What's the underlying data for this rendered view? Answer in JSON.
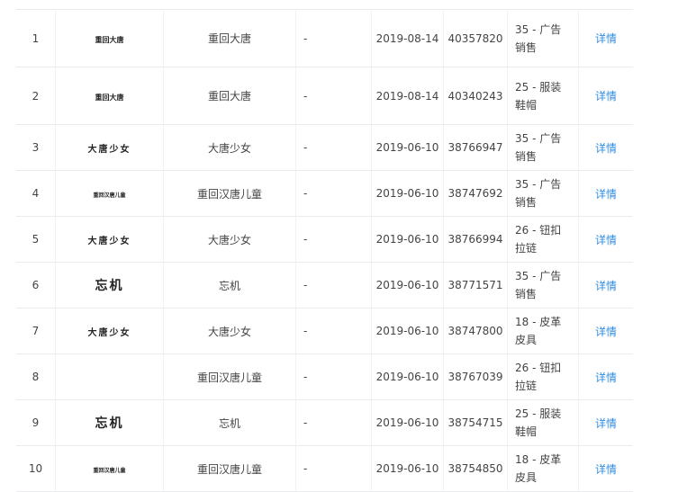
{
  "table": {
    "rows": [
      {
        "no": "1",
        "logo": "重回大唐",
        "name": "重回大唐",
        "dash": "-",
        "date": "2019-08-14",
        "reg": "40357820",
        "class": "35 - 广告销售",
        "link": "详情"
      },
      {
        "no": "2",
        "logo": "重回大唐",
        "name": "重回大唐",
        "dash": "-",
        "date": "2019-08-14",
        "reg": "40340243",
        "class": "25 - 服装鞋帽",
        "link": "详情"
      },
      {
        "no": "3",
        "logo": "大唐少女",
        "name": "大唐少女",
        "dash": "-",
        "date": "2019-06-10",
        "reg": "38766947",
        "class": "35 - 广告销售",
        "link": "详情"
      },
      {
        "no": "4",
        "logo": "重回汉唐儿童",
        "name": "重回汉唐儿童",
        "dash": "-",
        "date": "2019-06-10",
        "reg": "38747692",
        "class": "35 - 广告销售",
        "link": "详情"
      },
      {
        "no": "5",
        "logo": "大唐少女",
        "name": "大唐少女",
        "dash": "-",
        "date": "2019-06-10",
        "reg": "38766994",
        "class": "26 - 钮扣拉链",
        "link": "详情"
      },
      {
        "no": "6",
        "logo": "忘机",
        "name": "忘机",
        "dash": "-",
        "date": "2019-06-10",
        "reg": "38771571",
        "class": "35 - 广告销售",
        "link": "详情"
      },
      {
        "no": "7",
        "logo": "大唐少女",
        "name": "大唐少女",
        "dash": "-",
        "date": "2019-06-10",
        "reg": "38747800",
        "class": "18 - 皮革皮具",
        "link": "详情"
      },
      {
        "no": "8",
        "logo": "",
        "name": "重回汉唐儿童",
        "dash": "-",
        "date": "2019-06-10",
        "reg": "38767039",
        "class": "26 - 钮扣拉链",
        "link": "详情"
      },
      {
        "no": "9",
        "logo": "忘机",
        "name": "忘机",
        "dash": "-",
        "date": "2019-06-10",
        "reg": "38754715",
        "class": "25 - 服装鞋帽",
        "link": "详情"
      },
      {
        "no": "10",
        "logo": "重回汉唐儿童",
        "name": "重回汉唐儿童",
        "dash": "-",
        "date": "2019-06-10",
        "reg": "38754850",
        "class": "18 - 皮革皮具",
        "link": "详情"
      }
    ]
  },
  "colors": {
    "link": "#2f8de0",
    "border": "#e8ecf0",
    "text": "#444444"
  }
}
